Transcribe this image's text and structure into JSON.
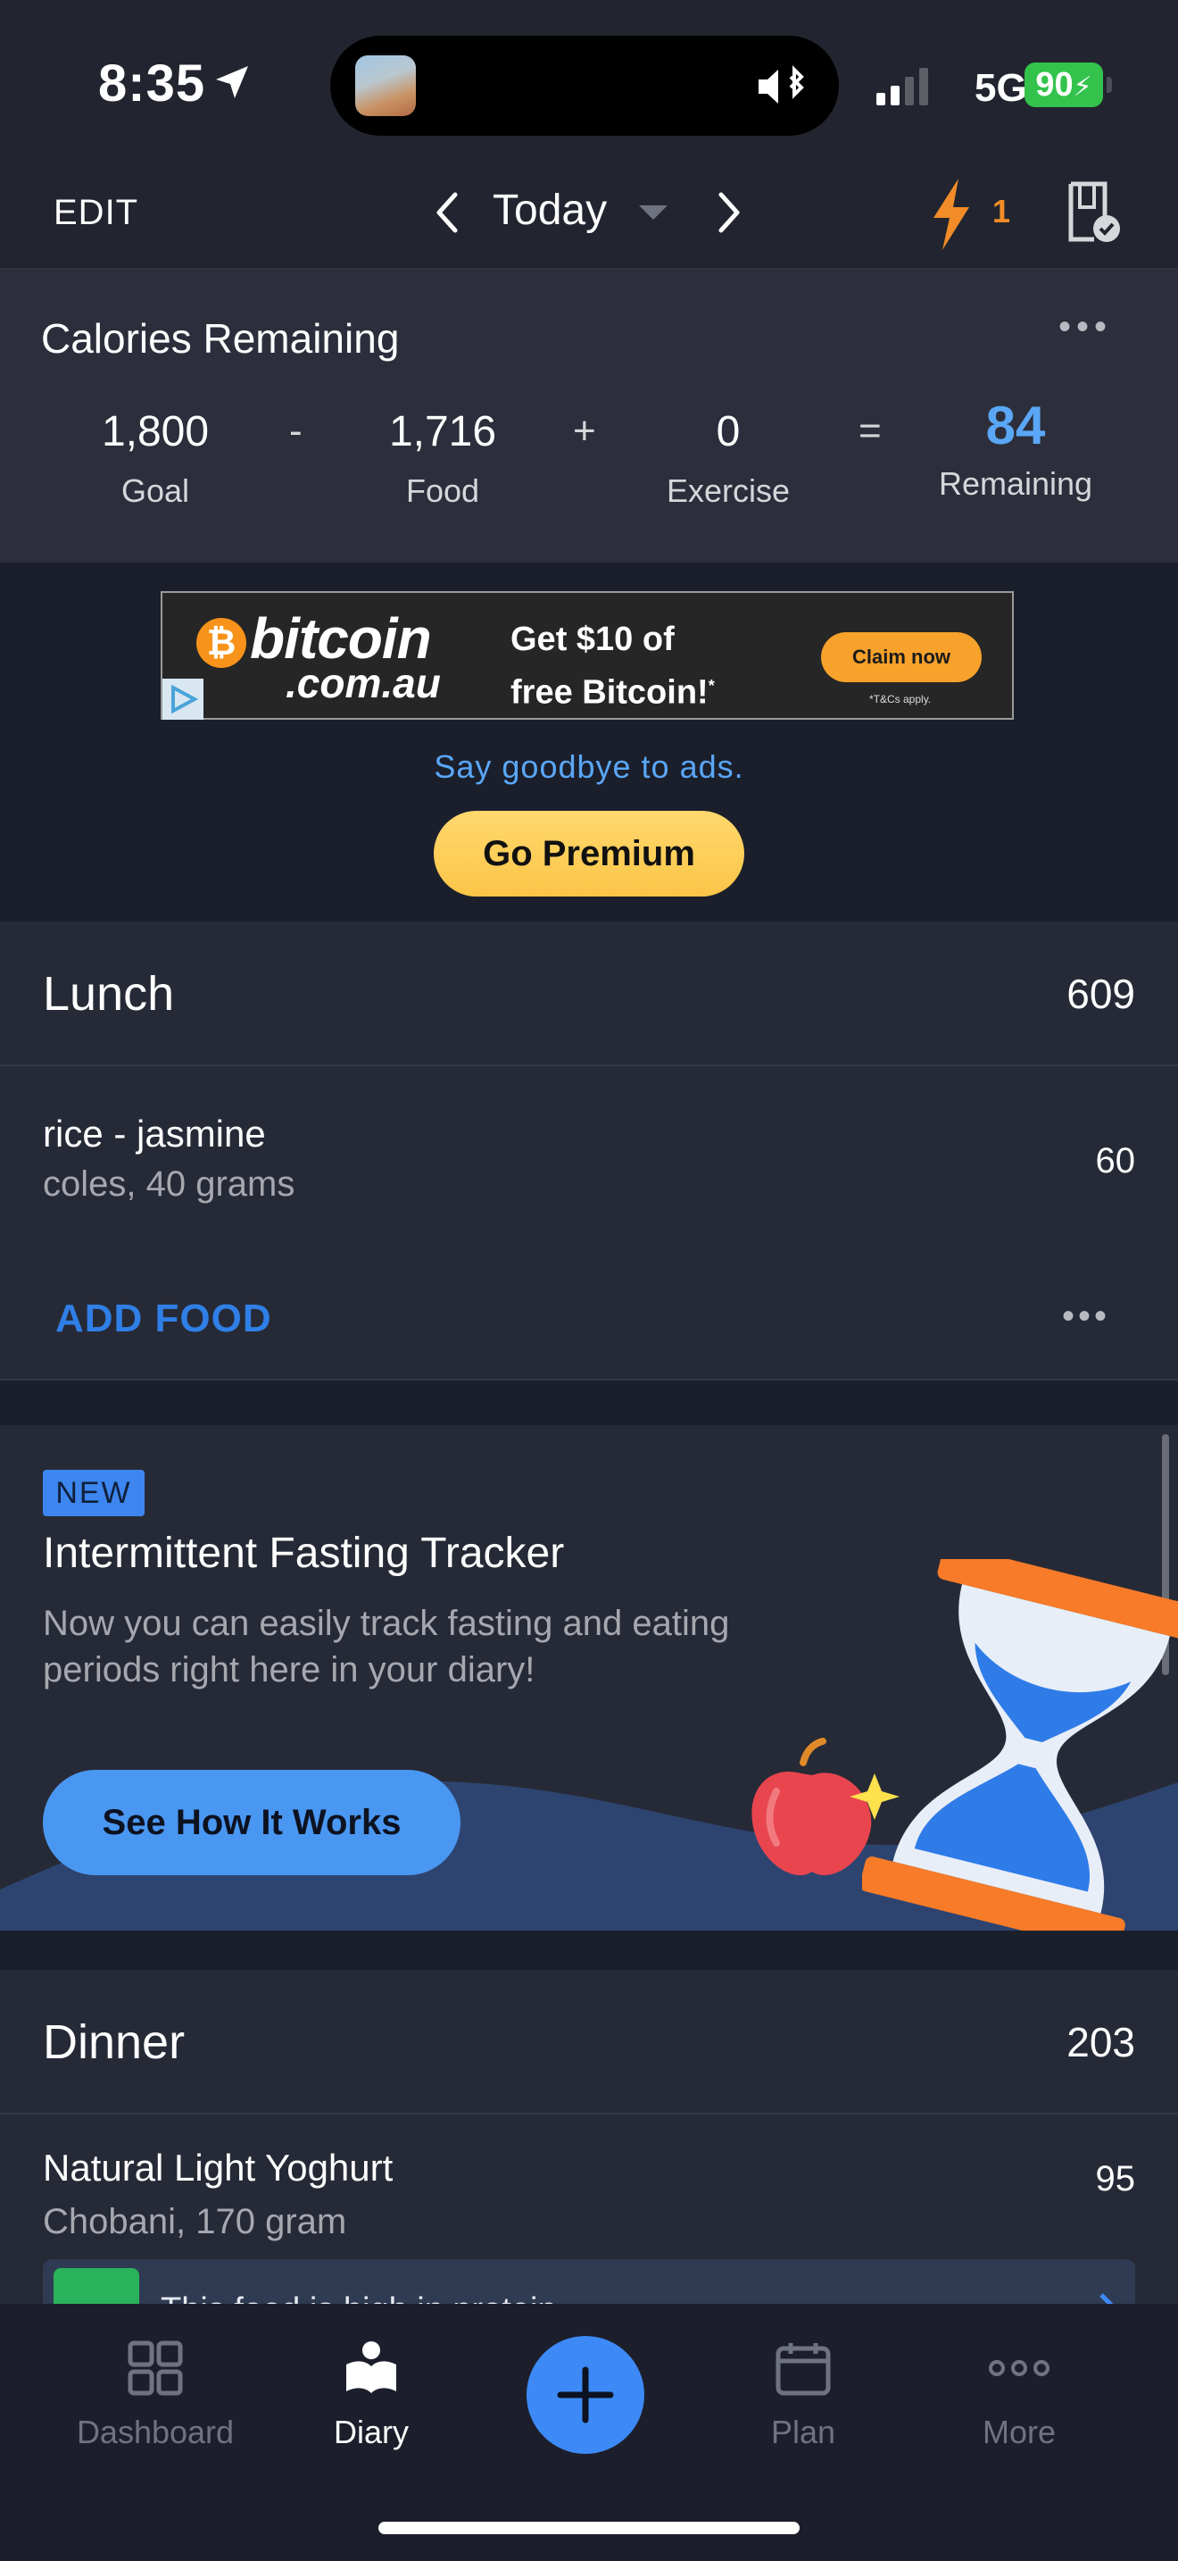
{
  "status_bar": {
    "time": "8:35",
    "network": "5G",
    "battery": "90"
  },
  "header": {
    "edit_label": "EDIT",
    "date_label": "Today",
    "streak_count": "1"
  },
  "calories": {
    "title": "Calories Remaining",
    "goal": "1,800",
    "goal_label": "Goal",
    "op_minus": "-",
    "food": "1,716",
    "food_label": "Food",
    "op_plus": "+",
    "exercise": "0",
    "exercise_label": "Exercise",
    "op_equals": "=",
    "remaining": "84",
    "remaining_label": "Remaining"
  },
  "ad": {
    "brand": "bitcoin",
    "domain": ".com.au",
    "coin_symbol": "₿",
    "headline_1": "Get $10 of",
    "headline_2": "free Bitcoin!",
    "headline_mark": "*",
    "cta": "Claim now",
    "terms": "*T&Cs apply.",
    "goodbye_text": "Say goodbye to ads.",
    "premium_label": "Go Premium"
  },
  "lunch": {
    "name": "Lunch",
    "calories": "609",
    "items": [
      {
        "name": "rice - jasmine",
        "detail": "coles, 40 grams",
        "calories": "60"
      }
    ],
    "add_food_label": "ADD FOOD"
  },
  "promo": {
    "badge": "NEW",
    "title": "Intermittent Fasting Tracker",
    "description": "Now you can easily track fasting and eating periods right here in your diary!",
    "button_label": "See How It Works"
  },
  "dinner": {
    "name": "Dinner",
    "calories": "203",
    "items": [
      {
        "name": "Natural Light Yoghurt",
        "detail": "Chobani, 170 gram",
        "calories": "95"
      }
    ],
    "banner_text": "This food is high in protein"
  },
  "tabbar": {
    "tabs": [
      {
        "label": "Dashboard",
        "active": false
      },
      {
        "label": "Diary",
        "active": true
      },
      {
        "label": "Plan",
        "active": false
      },
      {
        "label": "More",
        "active": false
      }
    ]
  },
  "colors": {
    "accent": "#3d8af7",
    "remaining": "#5aa7f7",
    "streak": "#f28c28",
    "premium": "#fbc547"
  }
}
